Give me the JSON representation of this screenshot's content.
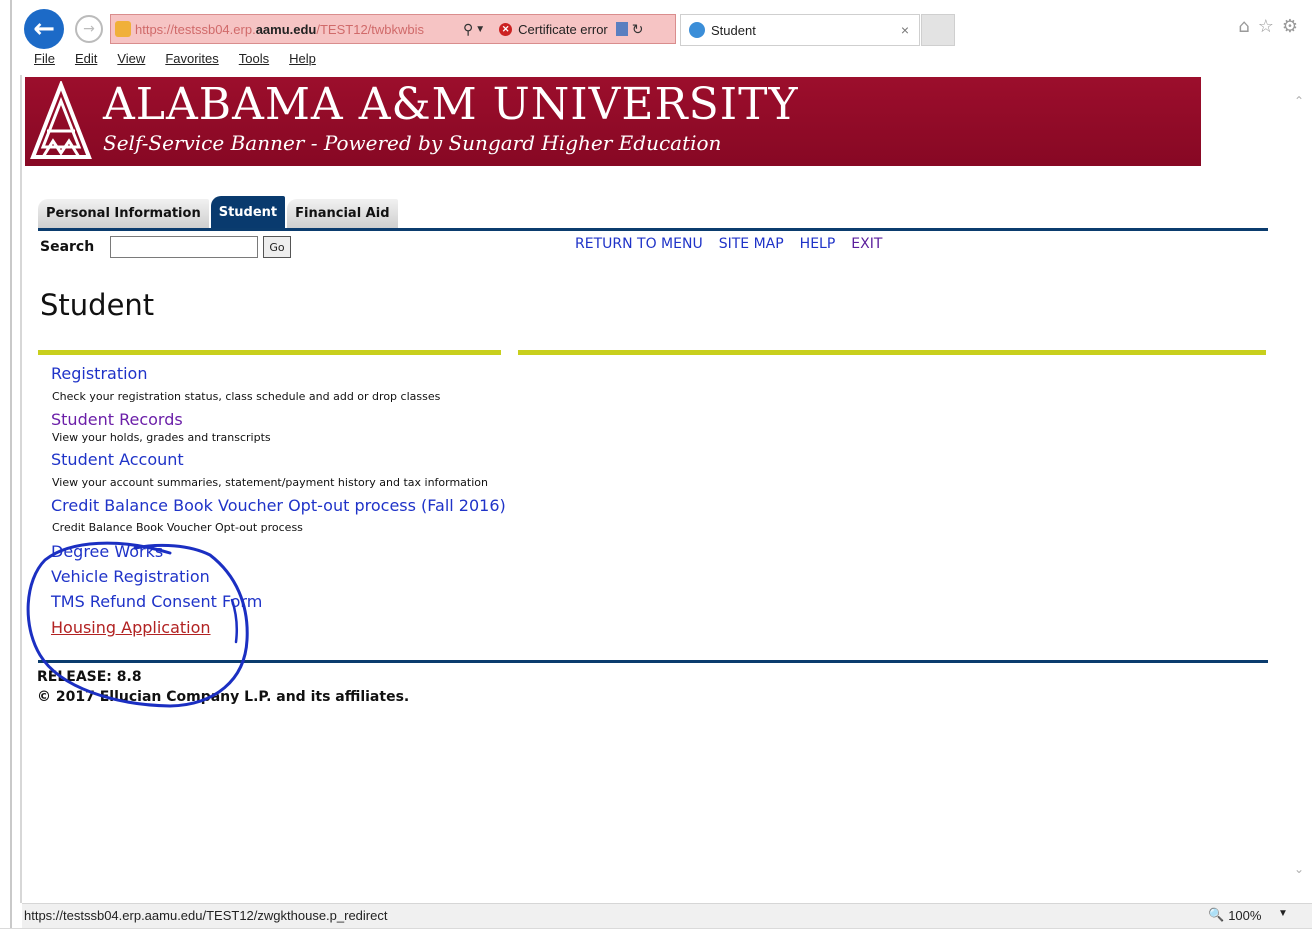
{
  "browser": {
    "url_prefix": "https://testssb04.erp.",
    "url_domain": "aamu.edu",
    "url_suffix": "/TEST12/twbkwbis",
    "certificate_error": "Certificate error",
    "tab_title": "Student",
    "tab_close": "×",
    "menu": [
      "File",
      "Edit",
      "View",
      "Favorites",
      "Tools",
      "Help"
    ],
    "icons": [
      "back-arrow-icon",
      "forward-arrow-icon",
      "search-icon",
      "refresh-icon",
      "home-icon",
      "star-icon",
      "gear-icon"
    ]
  },
  "banner": {
    "university": "ALABAMA A&M UNIVERSITY",
    "subtitle": "Self-Service Banner   -   Powered by Sungard Higher Education",
    "color": "#920b29"
  },
  "tabs": [
    {
      "label": "Personal Information"
    },
    {
      "label": "Student",
      "active": true
    },
    {
      "label": "Financial Aid"
    }
  ],
  "search": {
    "label": "Search",
    "value": "",
    "go_label": "Go"
  },
  "toplinks": [
    "RETURN TO MENU",
    "SITE MAP",
    "HELP",
    "EXIT"
  ],
  "page_title": "Student",
  "menu_items": [
    {
      "label": "Registration",
      "desc": "Check your registration status, class schedule and add or drop classes"
    },
    {
      "label": "Student Records",
      "desc": "View your holds, grades and transcripts"
    },
    {
      "label": "Student Account",
      "desc": "View your account summaries, statement/payment history and tax information"
    },
    {
      "label": "Credit Balance Book Voucher Opt-out process (Fall 2016)",
      "desc": "Credit Balance Book Voucher Opt-out process"
    },
    {
      "label": "Degree Works"
    },
    {
      "label": "Vehicle Registration"
    },
    {
      "label": "TMS Refund Consent Form"
    },
    {
      "label": "Housing Application"
    }
  ],
  "footer": {
    "release": "RELEASE: 8.8",
    "copyright": "© 2017 Ellucian Company L.P. and its affiliates."
  },
  "statusbar": {
    "url": "https://testssb04.erp.aamu.edu/TEST12/zwgkthouse.p_redirect",
    "zoom": "100%"
  },
  "colors": {
    "link": "#1f33c8",
    "visited_link": "#6b1fa8",
    "hover_link": "#b22222",
    "rule_yellow": "#c8cf1d",
    "rule_navy": "#0b3c6e",
    "pen_annotation": "#1b2fc2"
  }
}
